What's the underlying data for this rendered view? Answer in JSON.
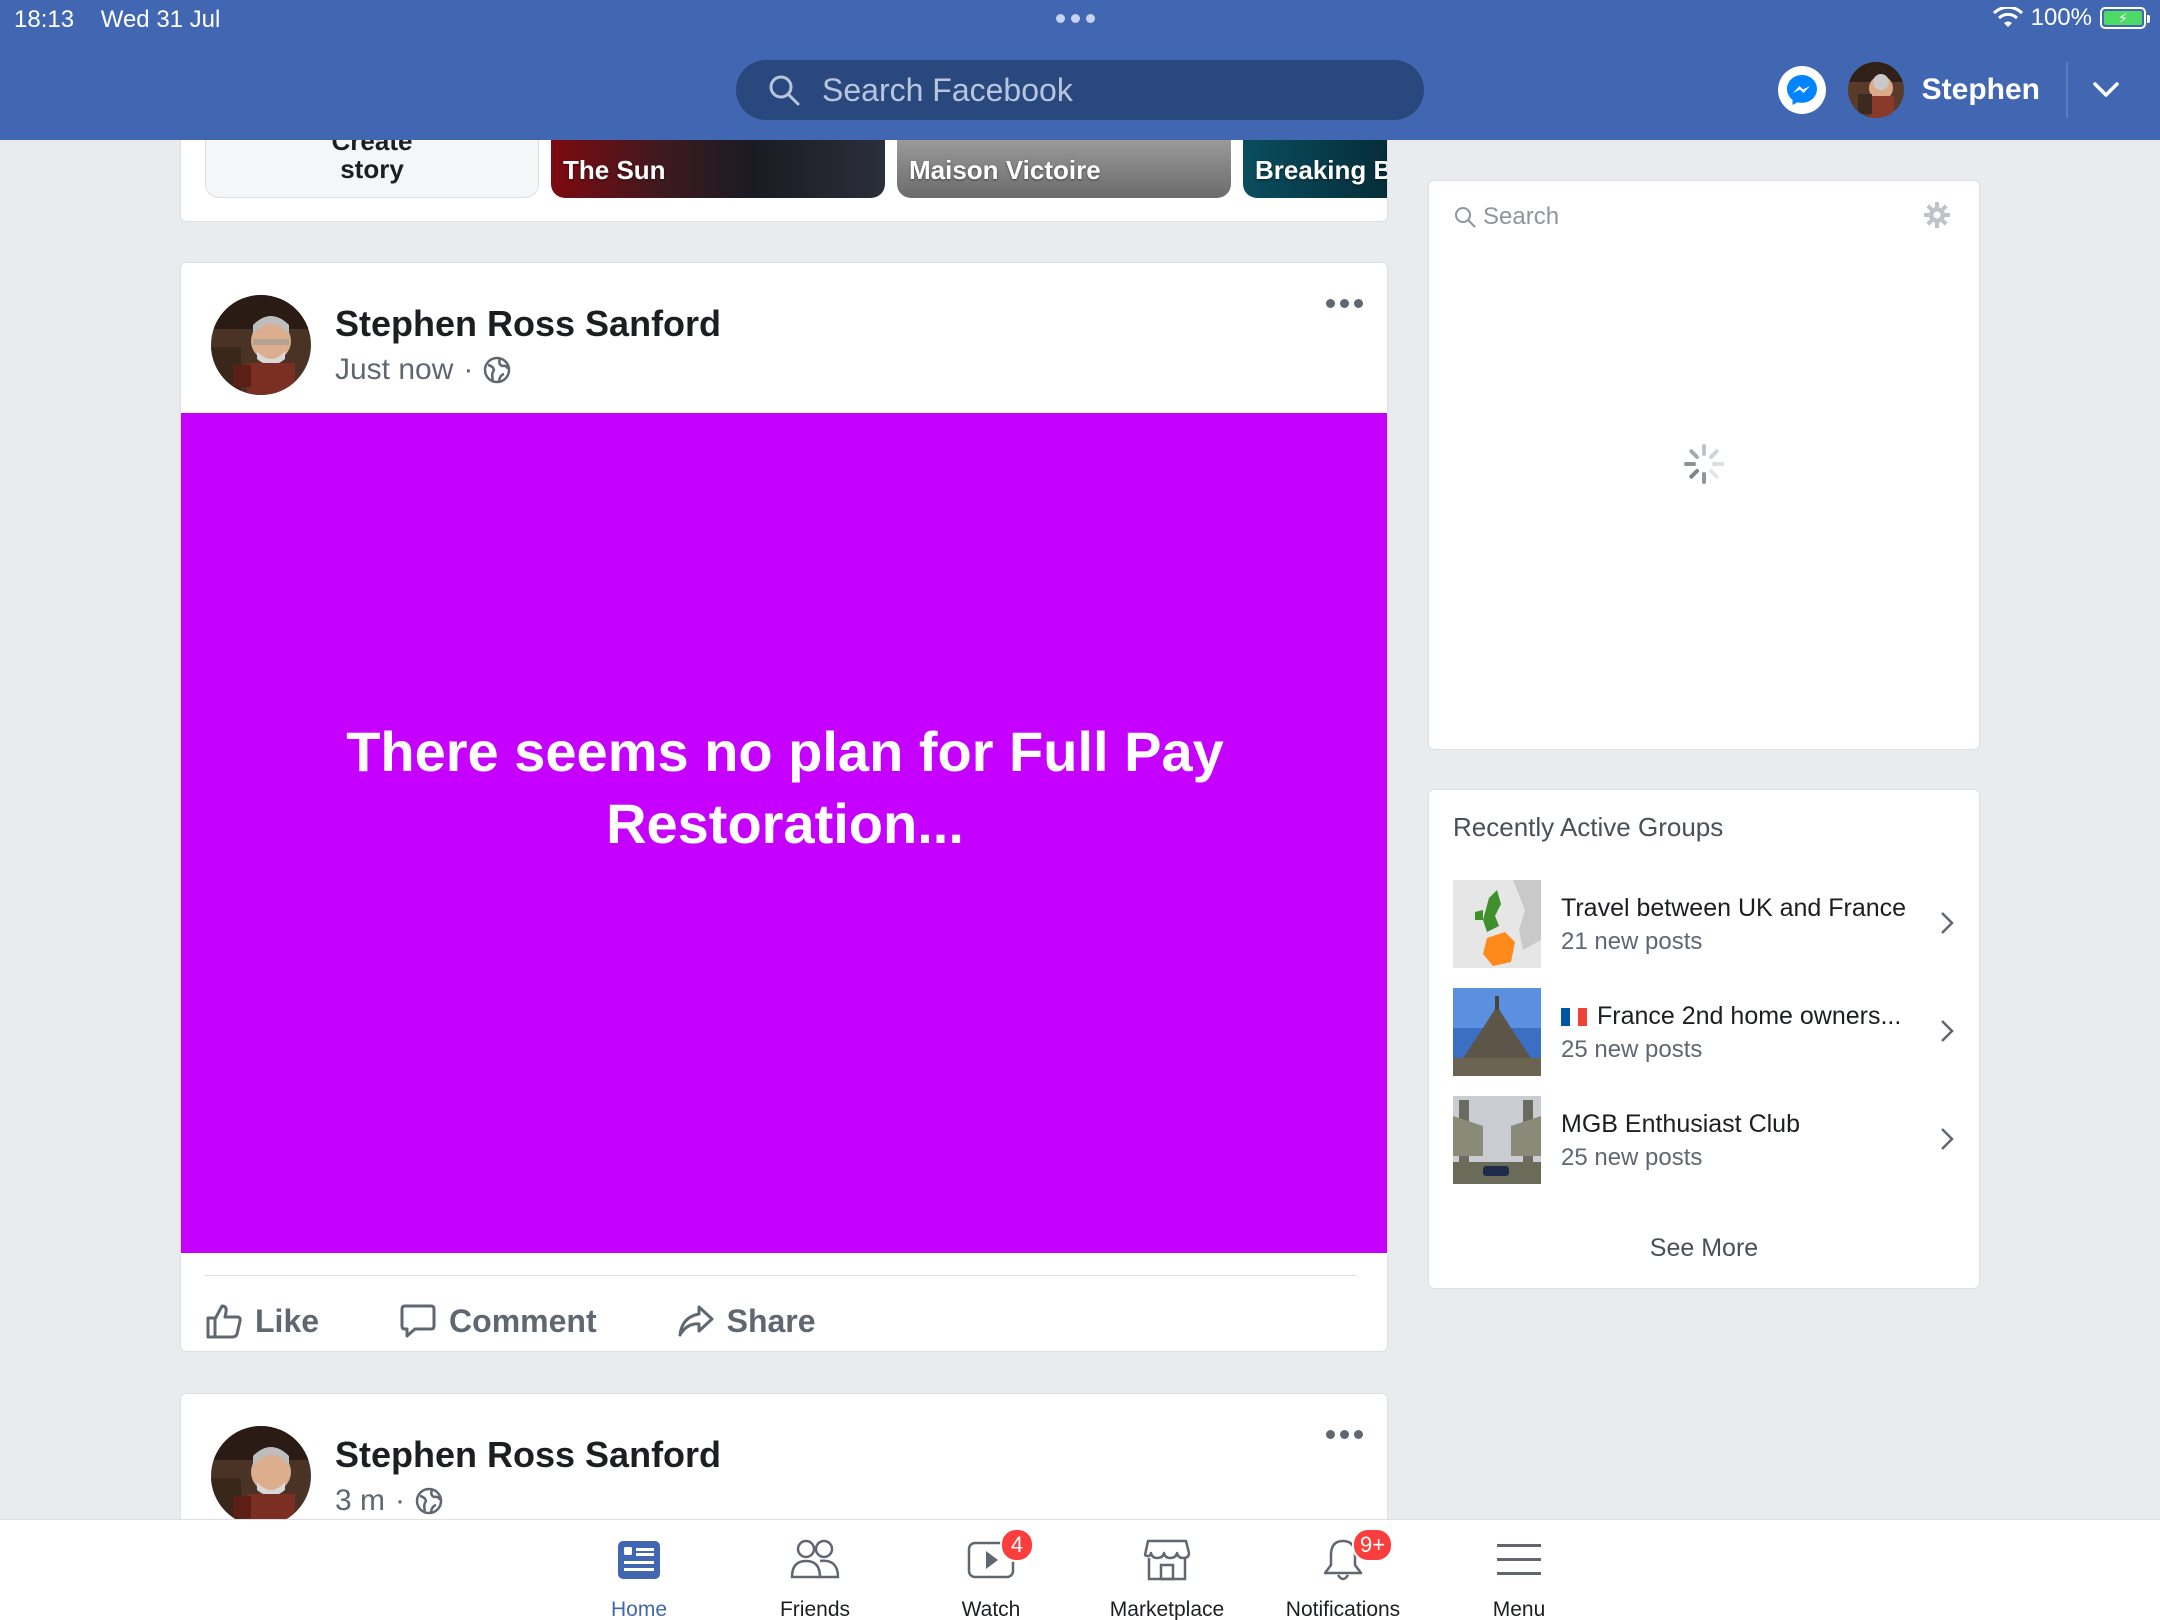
{
  "status_bar": {
    "time": "18:13",
    "date": "Wed 31 Jul",
    "battery": "100%"
  },
  "header": {
    "search_placeholder": "Search Facebook",
    "user_name": "Stephen",
    "brand_color": "#4267b2"
  },
  "stories": {
    "create_top": "Create",
    "create_label": "story",
    "items": [
      {
        "label": "The Sun"
      },
      {
        "label": "Maison Victoire"
      },
      {
        "label": "Breaking Br"
      }
    ]
  },
  "posts": [
    {
      "author": "Stephen Ross Sanford",
      "time": "Just now",
      "separator": "·",
      "background_color": "#c600ff",
      "text": "There seems no plan for Full Pay Restoration...",
      "actions": {
        "like": "Like",
        "comment": "Comment",
        "share": "Share"
      }
    },
    {
      "author": "Stephen Ross Sanford",
      "time": "3 m",
      "separator": "·"
    }
  ],
  "chat": {
    "search_placeholder": "Search"
  },
  "groups": {
    "title": "Recently Active Groups",
    "items": [
      {
        "name": "Travel between UK and France",
        "posts": "21 new posts"
      },
      {
        "name": "France 2nd home owners...",
        "posts": "25 new posts",
        "flag": "france"
      },
      {
        "name": "MGB Enthusiast Club",
        "posts": "25 new posts"
      }
    ],
    "see_more": "See More"
  },
  "tabbar": {
    "items": [
      {
        "label": "Home",
        "icon": "home-feed-icon",
        "active": true
      },
      {
        "label": "Friends",
        "icon": "friends-icon"
      },
      {
        "label": "Watch",
        "icon": "watch-icon",
        "badge": "4"
      },
      {
        "label": "Marketplace",
        "icon": "marketplace-icon"
      },
      {
        "label": "Notifications",
        "icon": "bell-icon",
        "badge": "9+"
      },
      {
        "label": "Menu",
        "icon": "hamburger-menu-icon"
      }
    ]
  }
}
